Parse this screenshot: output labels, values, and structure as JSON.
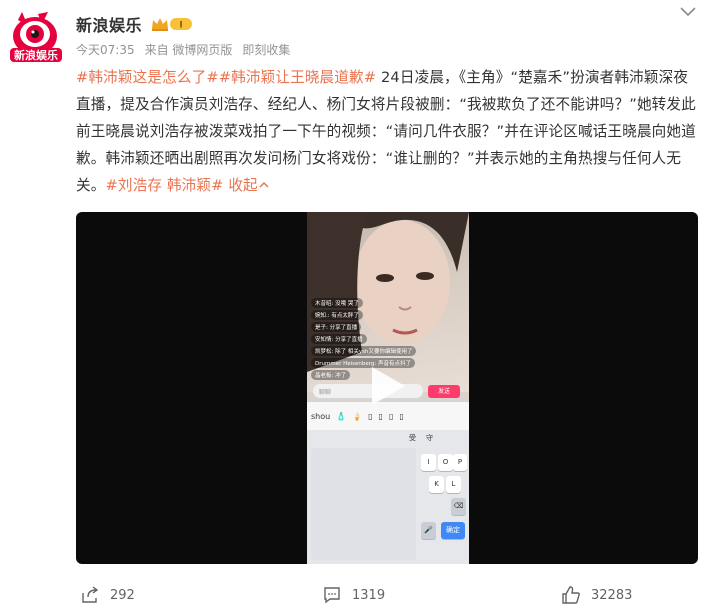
{
  "post": {
    "author": "新浪娱乐",
    "vip_badge": "I",
    "time": "今天07:35",
    "source": "来自 微博网页版",
    "favorite": "即刻收集",
    "avatar_text": "新浪娱乐",
    "text": {
      "tag1": "#韩沛颖这是怎么了#",
      "tag2": "#韩沛颖让王晓晨道歉#",
      "body": " 24日凌晨，《主角》“楚嘉禾”扮演者韩沛颖深夜直播，提及合作演员刘浩存、经纪人、杨门女将片段被删：“我被欺负了还不能讲吗？”她转发此前王晓晨说刘浩存被泼菜戏拍了一下午的视频：“请问几件衣服？”并在评论区喊话王晓晨向她道歉。韩沛颖还晒出剧照再次发问杨门女将戏份：“谁让删的？”并表示她的主角热搜与任何人无关。",
      "tag3": "#刘浩存 韩沛颖#",
      "collapse": "收起"
    }
  },
  "video": {
    "comments": [
      "木昔昭: 没哦 哭了",
      "婉知.: 有点太胖了",
      "是子: 分享了直播",
      "安知情: 分享了直播",
      "凯梦松: 除了 相关ysh又要你编辑使用了",
      "Drummer Heisenberg: 声音有点抖了",
      "晶老板: 冲了"
    ],
    "input_placeholder": "聊聊",
    "send_label": "发送",
    "sticker_label": "shou",
    "kb_top": [
      "受",
      "守"
    ],
    "keys_row1": [
      "I",
      "O",
      "P"
    ],
    "keys_row2": [
      "K",
      "L"
    ],
    "confirm_key": "确定"
  },
  "actions": {
    "repost": "292",
    "comment": "1319",
    "like": "32283"
  },
  "colors": {
    "link": "#eb7350",
    "meta": "#939393"
  }
}
